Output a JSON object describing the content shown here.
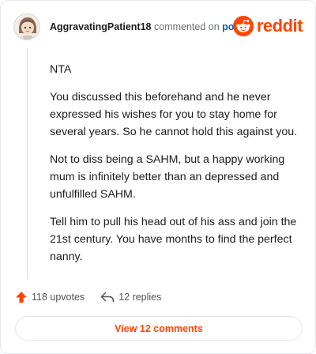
{
  "comment": {
    "author": "AggravatingPatient18",
    "action_text": "commented on",
    "post_link_label": "post",
    "paragraphs": [
      "NTA",
      "You discussed this beforehand and he never expressed his wishes for you to stay home for several years. So he cannot hold this against you.",
      "Not to diss being a SAHM, but a happy working mum is infinitely better than an depressed and unfulfilled SAHM.",
      "Tell him to pull his head out of his ass and join the 21st century. You have months to find the perfect nanny."
    ]
  },
  "brand": {
    "name": "reddit",
    "icon": "reddit-logo-icon",
    "color": "#ff4500"
  },
  "stats": {
    "upvotes_label": "118 upvotes",
    "upvote_icon": "upvote-arrow-icon",
    "replies_label": "12 replies",
    "reply_icon": "reply-arrow-icon"
  },
  "footer": {
    "view_comments_label": "View 12 comments"
  },
  "colors": {
    "accent": "#ff4500",
    "link": "#0b5fb8",
    "muted": "#6b6f73"
  }
}
